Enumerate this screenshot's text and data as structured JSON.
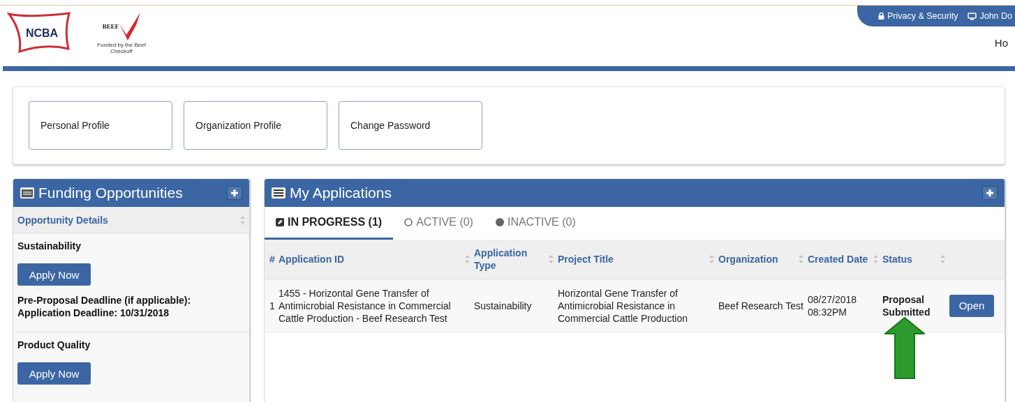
{
  "header": {
    "logo": {
      "text": "NCBA"
    },
    "checkoff_logo": {
      "text": "BEEF",
      "caption": "Funded by the Beef Checkoff"
    },
    "top_links": [
      "Privacy & Security",
      "John Do"
    ],
    "nav_cut": "Ho"
  },
  "profile_buttons": [
    "Personal Profile",
    "Organization Profile",
    "Change Password"
  ],
  "funding": {
    "title": "Funding Opportunities",
    "column": "Opportunity Details",
    "items": [
      {
        "name": "Sustainability",
        "button": "Apply Now",
        "deadlines": [
          "Pre-Proposal Deadline (if applicable):",
          "Application Deadline: 10/31/2018"
        ]
      },
      {
        "name": "Product Quality",
        "button": "Apply Now"
      }
    ]
  },
  "applications": {
    "title": "My Applications",
    "tabs": [
      {
        "label": "IN PROGRESS (1)",
        "kind": "edit",
        "selected": true
      },
      {
        "label": "ACTIVE (0)",
        "kind": "ring",
        "selected": false
      },
      {
        "label": "INACTIVE (0)",
        "kind": "dot",
        "selected": false
      }
    ],
    "columns": [
      "#",
      "Application ID",
      "Application Type",
      "Project Title",
      "Organization",
      "Created Date",
      "Status"
    ],
    "rows": [
      {
        "cells": [
          "1",
          "1455 - Horizontal Gene Transfer of Antimicrobial Resistance in Commercial Cattle Production - Beef Research Test",
          "Sustainability",
          "Horizontal Gene Transfer of Antimicrobial Resistance in Commercial Cattle Production",
          "Beef Research Test",
          "08/27/2018 08:32PM",
          "Proposal Submitted"
        ],
        "action": "Open"
      }
    ]
  },
  "annotation": {
    "kind": "arrow"
  }
}
